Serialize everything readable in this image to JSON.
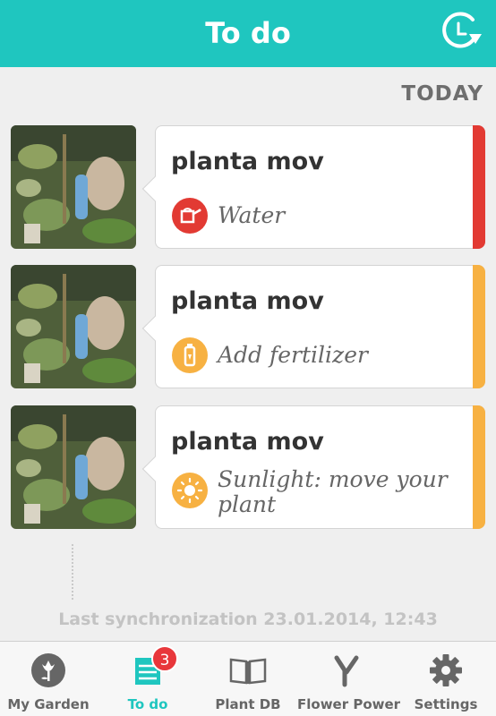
{
  "header": {
    "title": "To do",
    "history_icon": "clock-refresh-icon"
  },
  "section": {
    "label": "TODAY"
  },
  "tasks": [
    {
      "plant": "planta mov",
      "action": "Water",
      "action_icon": "watering-can-icon",
      "color": "#e23a33",
      "icon_bg": "#e23a33"
    },
    {
      "plant": "planta mov",
      "action": "Add fertilizer",
      "action_icon": "fertilizer-bottle-icon",
      "color": "#f7b142",
      "icon_bg": "#f7b142"
    },
    {
      "plant": "planta mov",
      "action": "Sunlight: move your plant",
      "action_icon": "sun-icon",
      "color": "#f7b142",
      "icon_bg": "#f7b142"
    }
  ],
  "sync": {
    "text": "Last synchronization 23.01.2014, 12:43"
  },
  "tabbar": {
    "accent": "#1fc6bf",
    "items": [
      {
        "label": "My Garden",
        "icon": "flower-circle-icon",
        "active": false
      },
      {
        "label": "To do",
        "icon": "todo-list-icon",
        "active": true,
        "badge": "3"
      },
      {
        "label": "Plant DB",
        "icon": "open-book-icon",
        "active": false
      },
      {
        "label": "Flower Power",
        "icon": "y-sensor-icon",
        "active": false
      },
      {
        "label": "Settings",
        "icon": "gear-icon",
        "active": false
      }
    ]
  }
}
